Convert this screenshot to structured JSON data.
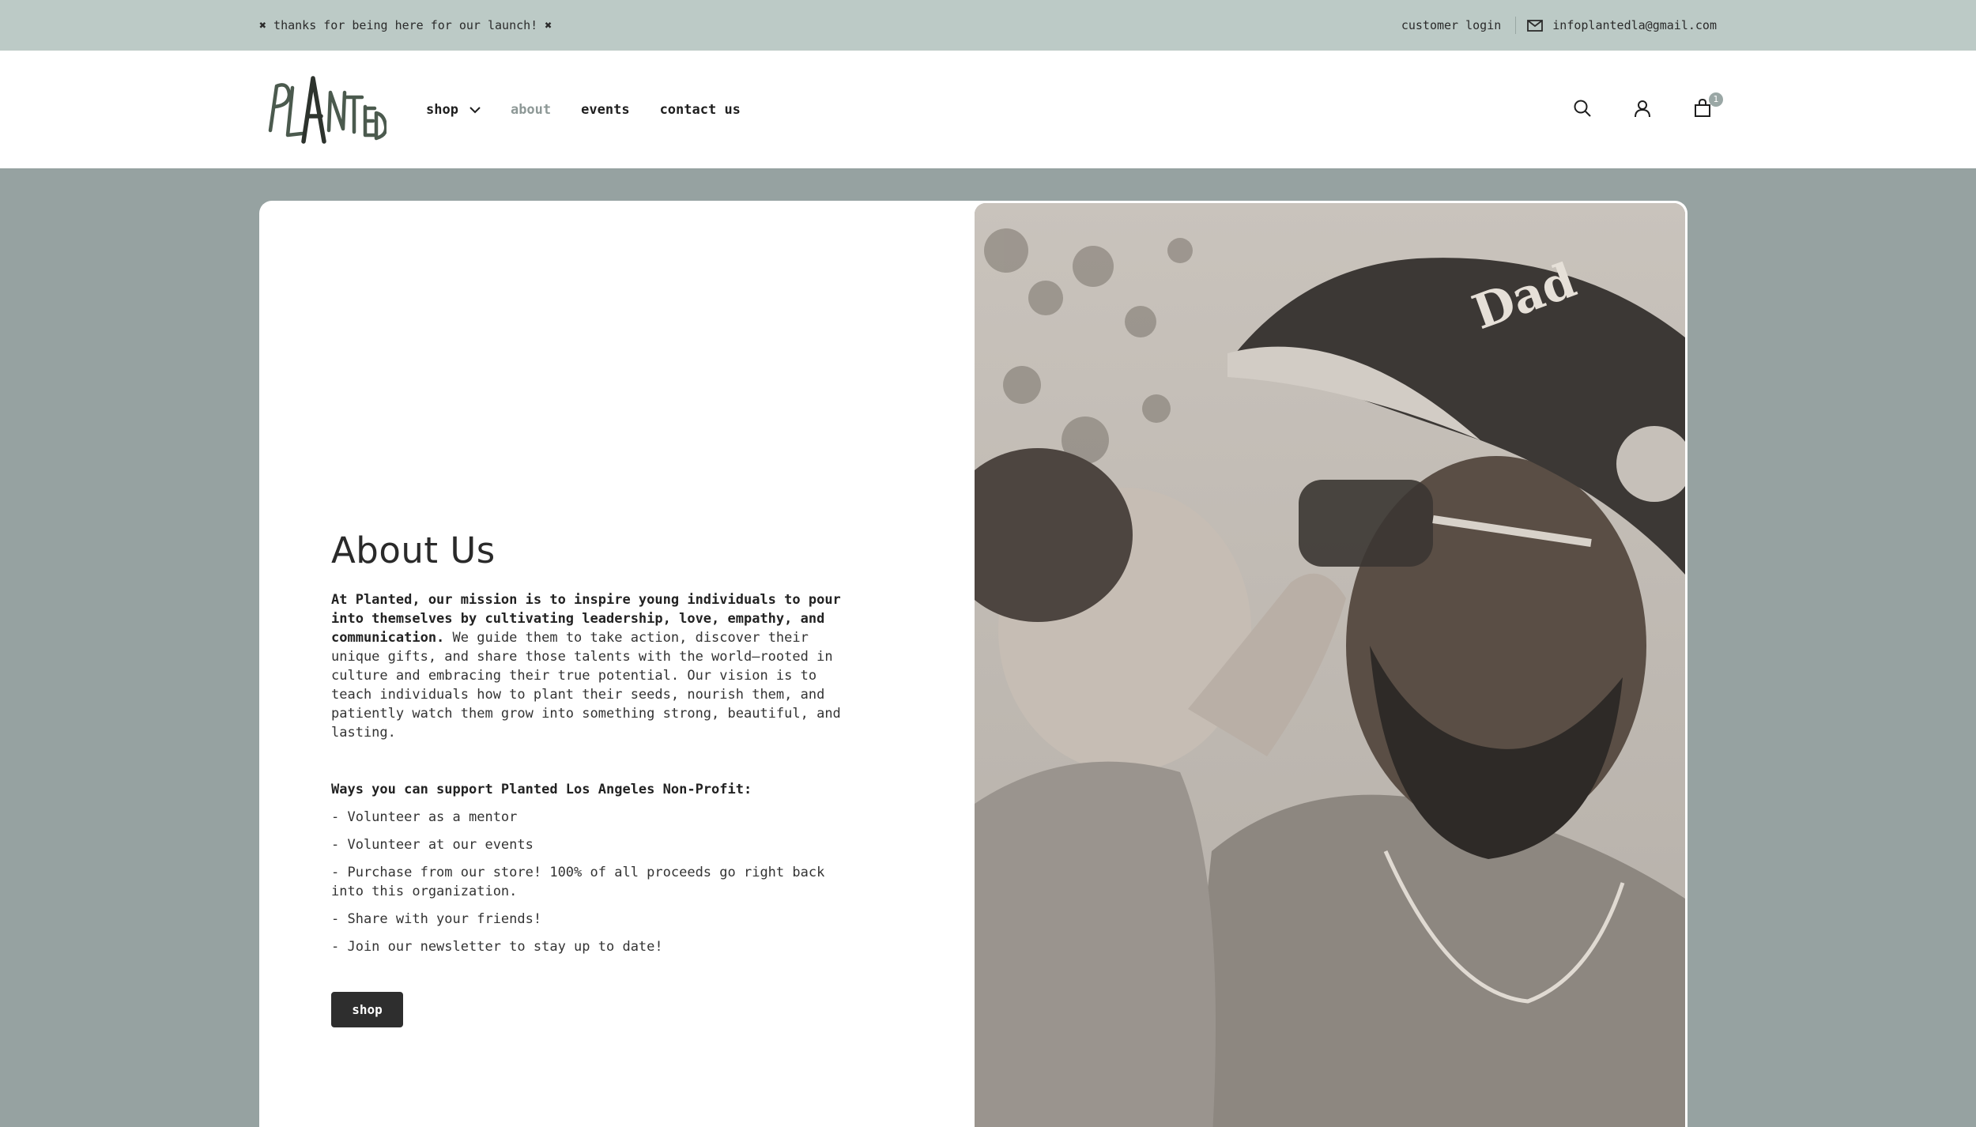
{
  "announcement": {
    "message": "✖ thanks for being here for our launch! ✖",
    "customer_login": "customer login",
    "email": "infoplantedla@gmail.com"
  },
  "header": {
    "logo_text": "PLANTED",
    "nav": [
      {
        "label": "shop",
        "has_dropdown": true
      },
      {
        "label": "about",
        "active": true
      },
      {
        "label": "events"
      },
      {
        "label": "contact us"
      }
    ],
    "icons": [
      "search-icon",
      "account-icon",
      "cart-icon"
    ],
    "cart_count": "1"
  },
  "about": {
    "title": "About Us",
    "intro_bold": "At Planted, our mission is to inspire young individuals to pour into themselves by cultivating leadership, love, empathy, and communication.",
    "intro_rest": " We guide them to take action, discover their unique gifts, and share those talents with the world—rooted in culture and embracing their true potential. Our vision is to teach individuals how to plant their seeds, nourish them, and patiently watch them grow into something strong, beautiful, and lasting.",
    "ways_title": "Ways you can support Planted Los Angeles Non-Profit:",
    "ways": [
      "- Volunteer as a mentor",
      "- Volunteer at our events",
      "- Purchase from our store! 100% of all proceeds go right back into this organization.",
      "- Share with your friends!",
      "- Join our newsletter to stay up to date!"
    ],
    "button_label": "shop"
  },
  "colors": {
    "announcement_bg": "#bccac6",
    "page_bg": "#96a2a1",
    "button_bg": "#2e2e2e",
    "active_nav": "#8d9896"
  }
}
